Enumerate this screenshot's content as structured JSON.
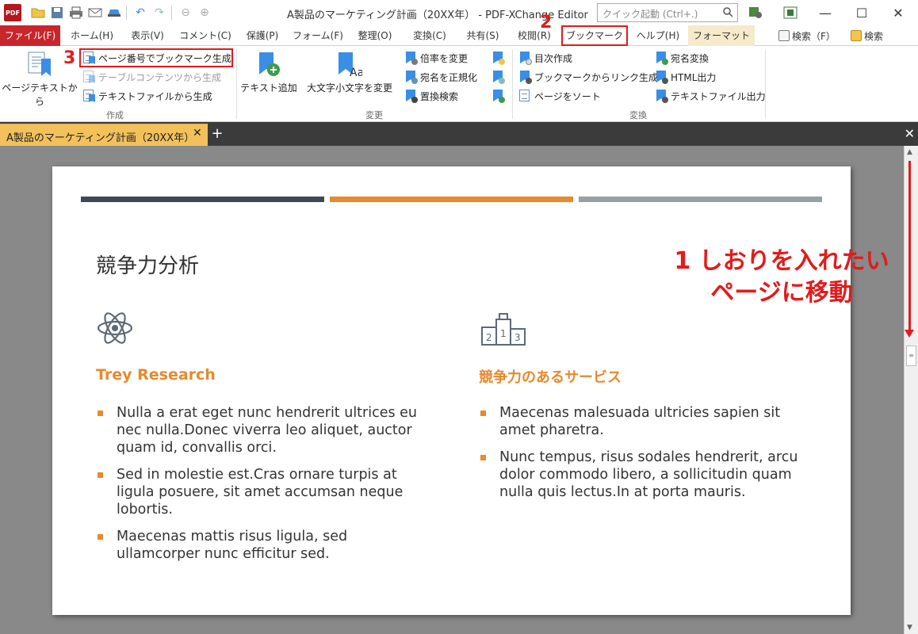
{
  "titlebar": {
    "app_logo": "PDF",
    "title": "A製品のマーケティング計画（20XX年） - PDF-XChange Editor",
    "quick_launch_placeholder": "クイック起動 (Ctrl+.)",
    "icons": [
      "folder-open-icon",
      "save-icon",
      "print-icon",
      "email-icon",
      "scanner-icon",
      "undo-icon",
      "redo-icon",
      "nav-back-icon",
      "nav-forward-icon"
    ],
    "minimize": "—",
    "maximize": "☐",
    "close": "✕"
  },
  "ribbon_tabs": [
    {
      "label": "ファイル(F)"
    },
    {
      "label": "ホーム(H)"
    },
    {
      "label": "表示(V)"
    },
    {
      "label": "コメント(C)"
    },
    {
      "label": "保護(P)"
    },
    {
      "label": "フォーム(F)"
    },
    {
      "label": "整理(O)"
    },
    {
      "label": "変換(C)"
    },
    {
      "label": "共有(S)"
    },
    {
      "label": "校閲(R)"
    },
    {
      "label": "ブックマーク"
    },
    {
      "label": "ヘルプ(H)"
    },
    {
      "label": "フォーマット"
    }
  ],
  "tab_search": {
    "find": "検索（F）",
    "search": "検索"
  },
  "ribbon": {
    "create_group": {
      "label": "作成",
      "page_text_button": "ページテキストから",
      "page_number_bookmark": "ページ番号でブックマーク生成",
      "table_contents": "テーブルコンテンツから生成",
      "text_file": "テキストファイルから生成"
    },
    "change_group": {
      "label": "変更",
      "add_text": "テキスト追加",
      "case_change": "大文字小文字を変更",
      "zoom_change": "倍率を変更",
      "normalize_dest": "宛名を正規化",
      "replace_search": "置換検索"
    },
    "convert_group": {
      "label": "変換",
      "toc": "目次作成",
      "links_from_bookmarks": "ブックマークからリンク生成",
      "sort_pages": "ページをソート",
      "convert_dest": "宛名変換",
      "html_export": "HTML出力",
      "text_export": "テキストファイル出力"
    }
  },
  "doc_tab": {
    "title": "A製品のマーケティング計画（20XX年）",
    "close": "✕",
    "add": "+",
    "close_all": "✕"
  },
  "slide": {
    "title": "競争力分析",
    "left": {
      "heading": "Trey Research",
      "bullets": [
        "Nulla a erat eget nunc hendrerit ultrices eu nec nulla.Donec viverra leo aliquet, auctor quam id, convallis orci.",
        "Sed in molestie est.Cras ornare turpis at ligula posuere, sit amet accumsan neque lobortis.",
        "Maecenas mattis risus ligula, sed ullamcorper nunc efficitur sed."
      ]
    },
    "right": {
      "heading": "競争力のあるサービス",
      "bullets": [
        "Maecenas malesuada ultricies sapien sit amet pharetra.",
        "Nunc tempus, risus sodales hendrerit, arcu dolor commodo libero, a sollicitudin quam nulla quis lectus.In at porta mauris."
      ]
    },
    "podium_numbers": [
      "2",
      "1",
      "3"
    ],
    "stripe_colors": [
      "#3d4a54",
      "#e8892c",
      "#98a0a6"
    ],
    "accent_color": "#e8892c"
  },
  "scrollbar": {
    "up": "▲",
    "down": "▼",
    "thumb_grip": "≡"
  },
  "annotations": {
    "step1_line1": "1 しおりを入れたい",
    "step1_line2": "ページに移動",
    "step2": "2",
    "step3": "3",
    "color": "#e21b1b"
  }
}
